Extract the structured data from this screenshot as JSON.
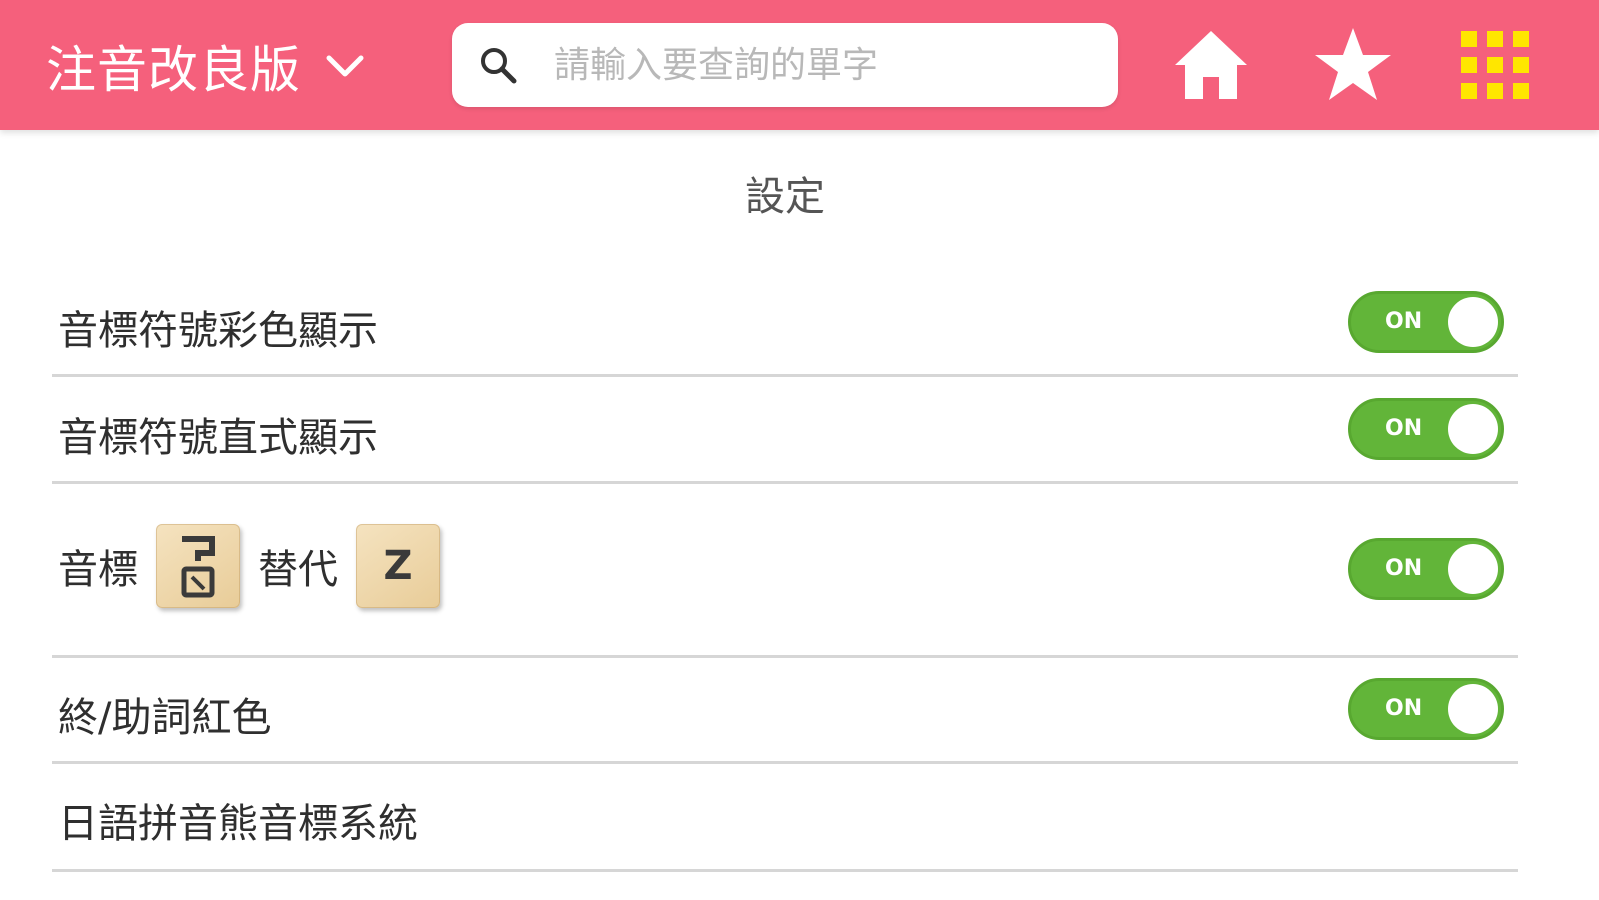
{
  "header": {
    "app_title": "注音改良版",
    "search_placeholder": "請輸入要查詢的單字",
    "search_value": ""
  },
  "page": {
    "title": "設定"
  },
  "settings": [
    {
      "label": "音標符號彩色顯示",
      "toggle": "ON"
    },
    {
      "label": "音標符號直式顯示",
      "toggle": "ON"
    },
    {
      "label_prefix": "音標",
      "tile_from": "ㄗ",
      "label_mid": "替代",
      "tile_to": "Z",
      "toggle": "ON"
    },
    {
      "label": "終/助詞紅色",
      "toggle": "ON"
    },
    {
      "label": "日語拼音熊音標系統"
    }
  ],
  "colors": {
    "header_bg": "#f5607c",
    "toggle_on": "#62b539",
    "grid_icon": "#ffe600"
  },
  "icons": [
    "chevron-down-icon",
    "search-icon",
    "home-icon",
    "star-icon",
    "grid-menu-icon"
  ]
}
